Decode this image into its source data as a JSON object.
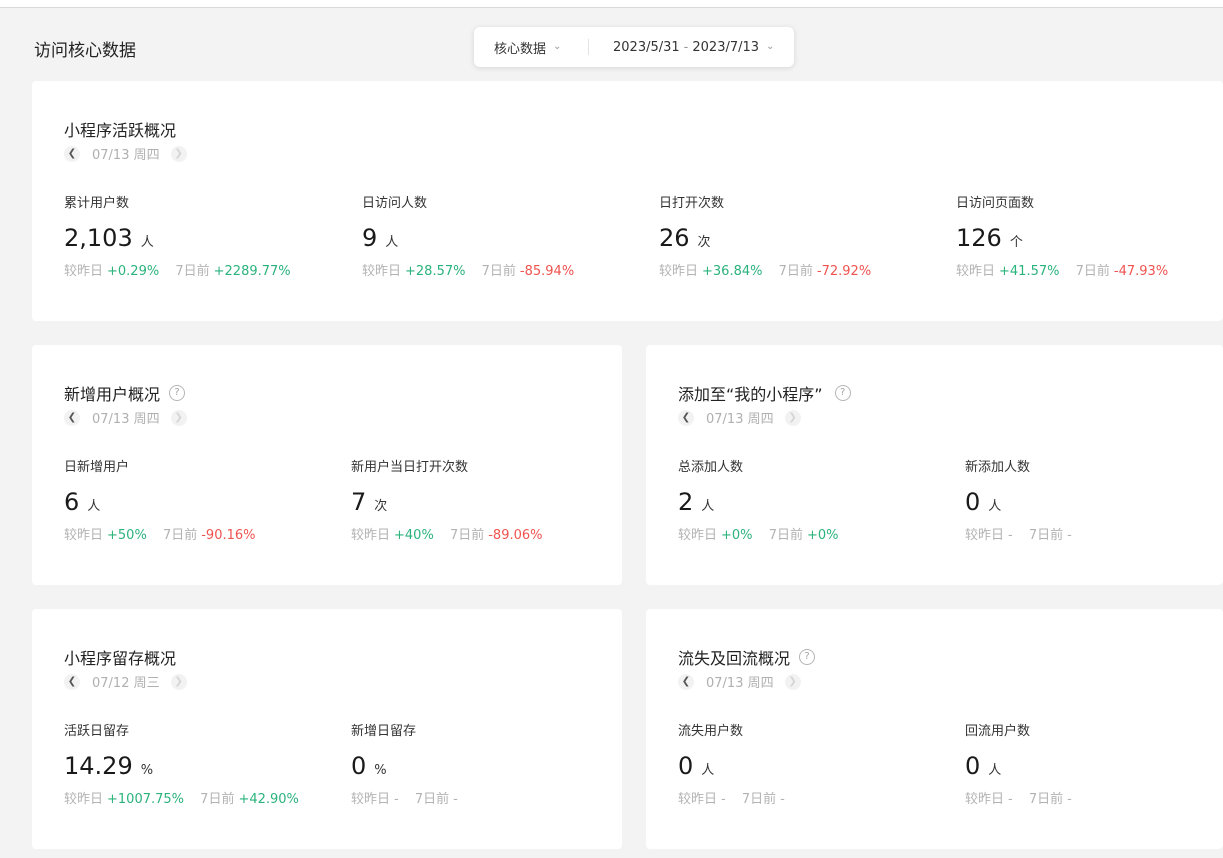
{
  "page_title": "访问核心数据",
  "filter": {
    "type_label": "核心数据",
    "date_start": "2023/5/31",
    "date_sep": "-",
    "date_end": "2023/7/13"
  },
  "compare_labels": {
    "day": "较昨日",
    "week": "7日前"
  },
  "colors": {
    "up": "#2bb37c",
    "down": "#ef5350",
    "neutral": "#b3b3b3",
    "background": "#f3f3f3"
  },
  "cards": {
    "active": {
      "title": "小程序活跃概况",
      "date": "07/13 周四",
      "metrics": [
        {
          "label": "累计用户数",
          "value": "2,103",
          "unit": "人",
          "day": "+0.29%",
          "week": "+2289.77%"
        },
        {
          "label": "日访问人数",
          "value": "9",
          "unit": "人",
          "day": "+28.57%",
          "week": "-85.94%"
        },
        {
          "label": "日打开次数",
          "value": "26",
          "unit": "次",
          "day": "+36.84%",
          "week": "-72.92%"
        },
        {
          "label": "日访问页面数",
          "value": "126",
          "unit": "个",
          "day": "+41.57%",
          "week": "-47.93%"
        }
      ]
    },
    "new_users": {
      "title": "新增用户概况",
      "date": "07/13 周四",
      "metrics": [
        {
          "label": "日新增用户",
          "value": "6",
          "unit": "人",
          "day": "+50%",
          "week": "-90.16%"
        },
        {
          "label": "新用户当日打开次数",
          "value": "7",
          "unit": "次",
          "day": "+40%",
          "week": "-89.06%"
        }
      ]
    },
    "add_to_my": {
      "title": "添加至“我的小程序”",
      "date": "07/13 周四",
      "metrics": [
        {
          "label": "总添加人数",
          "value": "2",
          "unit": "人",
          "day": "+0%",
          "week": "+0%"
        },
        {
          "label": "新添加人数",
          "value": "0",
          "unit": "人",
          "day": "-",
          "week": "-"
        }
      ]
    },
    "retention": {
      "title": "小程序留存概况",
      "date": "07/12 周三",
      "metrics": [
        {
          "label": "活跃日留存",
          "value": "14.29",
          "unit": "%",
          "day": "+1007.75%",
          "week": "+42.90%"
        },
        {
          "label": "新增日留存",
          "value": "0",
          "unit": "%",
          "day": "-",
          "week": "-"
        }
      ]
    },
    "churn": {
      "title": "流失及回流概况",
      "date": "07/13 周四",
      "metrics": [
        {
          "label": "流失用户数",
          "value": "0",
          "unit": "人",
          "day": "-",
          "week": "-"
        },
        {
          "label": "回流用户数",
          "value": "0",
          "unit": "人",
          "day": "-",
          "week": "-"
        }
      ]
    }
  }
}
